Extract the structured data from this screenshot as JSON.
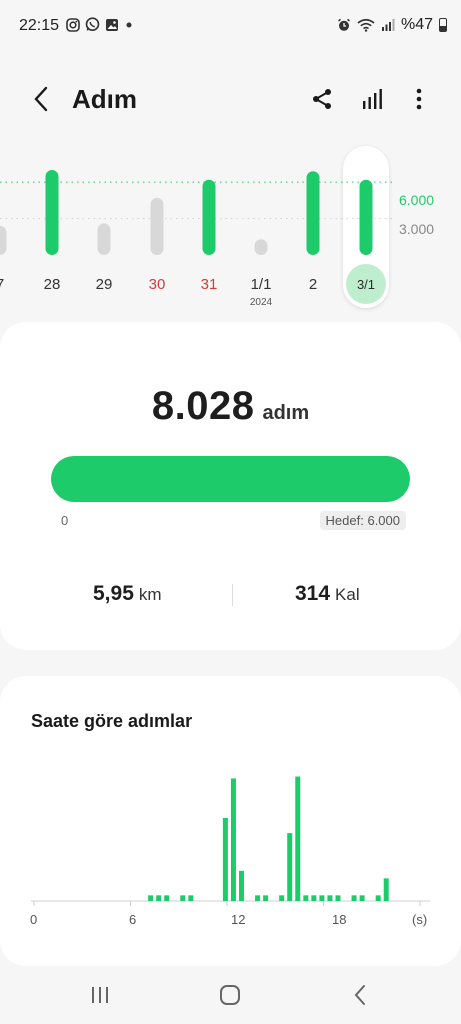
{
  "status": {
    "time": "22:15",
    "battery": "%47",
    "left_icons": [
      "instagram-icon",
      "whatsapp-icon",
      "gallery-icon",
      "dot-icon"
    ],
    "right_icons": [
      "alarm-icon",
      "wifi-icon",
      "signal-icon",
      "battery-icon"
    ]
  },
  "appbar": {
    "title": "Adım",
    "actions": [
      "share-icon",
      "stats-icon",
      "more-icon"
    ]
  },
  "week": {
    "days": [
      {
        "label": "7",
        "steps": 2400,
        "year": "",
        "red": false
      },
      {
        "label": "28",
        "steps": 7000,
        "year": "",
        "red": false
      },
      {
        "label": "29",
        "steps": 2600,
        "year": "",
        "red": false
      },
      {
        "label": "30",
        "steps": 4700,
        "year": "",
        "red": true
      },
      {
        "label": "31",
        "steps": 6200,
        "year": "",
        "red": true
      },
      {
        "label": "1/1",
        "steps": 1300,
        "year": "2024",
        "red": false
      },
      {
        "label": "2",
        "steps": 6900,
        "year": "",
        "red": false
      },
      {
        "label": "3/1",
        "steps": 6200,
        "year": "",
        "red": false,
        "selected": true
      }
    ],
    "goal": 6000,
    "axis": [
      "6.000",
      "3.000"
    ],
    "colors": {
      "achieved": "#1ecb6b",
      "missed": "#d8d8d8",
      "goal_line": "#1ecb6b"
    }
  },
  "summary": {
    "steps": "8.028",
    "steps_unit": "adım",
    "progress_min": "0",
    "progress": 1.0,
    "goal_label": "Hedef: 6.000",
    "distance": "5,95",
    "distance_unit": "km",
    "calories": "314",
    "calories_unit": "Kal"
  },
  "hourly": {
    "title": "Saate göre adımlar",
    "x_labels": [
      "0",
      "6",
      "12",
      "18",
      "(s)"
    ],
    "chart_data": {
      "type": "bar",
      "x_unit": "hour",
      "bars": [
        {
          "hour": 7.25,
          "value": 3
        },
        {
          "hour": 7.75,
          "value": 3
        },
        {
          "hour": 8.25,
          "value": 3
        },
        {
          "hour": 9.25,
          "value": 3
        },
        {
          "hour": 9.75,
          "value": 3
        },
        {
          "hour": 11.9,
          "value": 44
        },
        {
          "hour": 12.4,
          "value": 65
        },
        {
          "hour": 12.9,
          "value": 16
        },
        {
          "hour": 13.9,
          "value": 3
        },
        {
          "hour": 14.4,
          "value": 3
        },
        {
          "hour": 15.4,
          "value": 3
        },
        {
          "hour": 15.9,
          "value": 36
        },
        {
          "hour": 16.4,
          "value": 66
        },
        {
          "hour": 16.9,
          "value": 3
        },
        {
          "hour": 17.4,
          "value": 3
        },
        {
          "hour": 17.9,
          "value": 3
        },
        {
          "hour": 18.4,
          "value": 3
        },
        {
          "hour": 18.9,
          "value": 3
        },
        {
          "hour": 19.9,
          "value": 3
        },
        {
          "hour": 20.4,
          "value": 3
        },
        {
          "hour": 21.4,
          "value": 3
        },
        {
          "hour": 21.9,
          "value": 12
        }
      ],
      "xlim": [
        0,
        24
      ],
      "ylim": [
        0,
        70
      ]
    }
  },
  "navbar": {
    "buttons": [
      "recents-icon",
      "home-icon",
      "back-nav-icon"
    ]
  }
}
